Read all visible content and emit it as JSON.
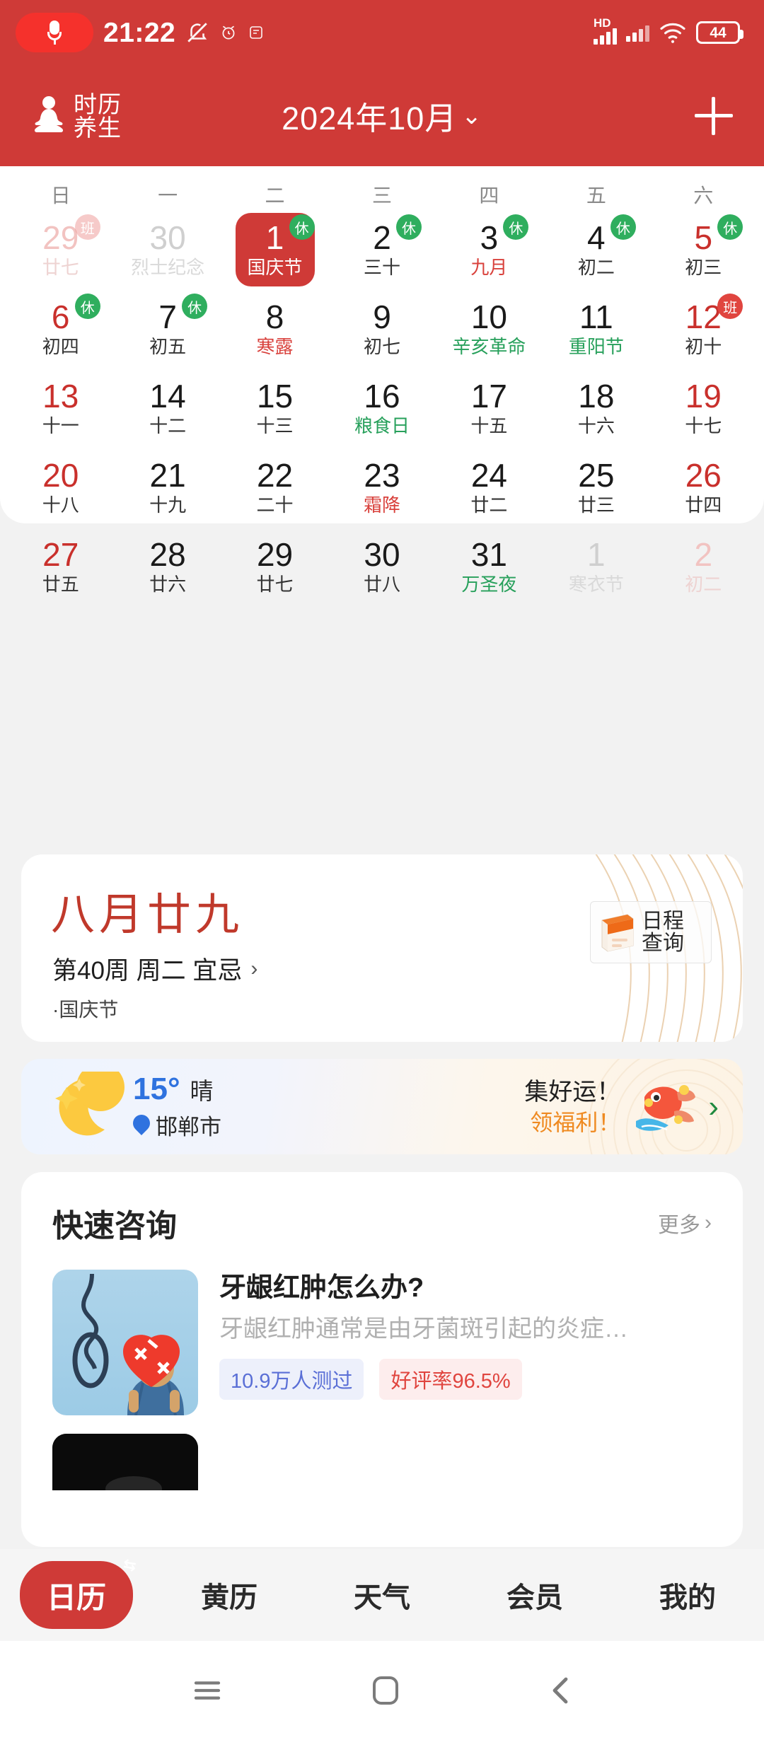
{
  "statusbar": {
    "time": "21:22",
    "battery_level": "44",
    "hd_label": "HD",
    "icons": [
      "mic-recording-icon",
      "bell-muted-icon",
      "alarm-icon",
      "app-icon"
    ]
  },
  "header": {
    "brand_line1": "时历",
    "brand_line2": "养生",
    "month_title": "2024年10月",
    "chevron": "⌄",
    "add_label": "+"
  },
  "calendar": {
    "weekdays": [
      "日",
      "一",
      "二",
      "三",
      "四",
      "五",
      "六"
    ],
    "weeks": [
      [
        {
          "num": "29",
          "sub": "廿七",
          "out": true,
          "weekend": true,
          "badge": "班",
          "badge_type": "work",
          "badge_pale": true
        },
        {
          "num": "30",
          "sub": "烈士纪念",
          "out": true
        },
        {
          "num": "1",
          "sub": "国庆节",
          "selected": true,
          "badge": "休",
          "badge_type": "rest"
        },
        {
          "num": "2",
          "sub": "三十",
          "badge": "休",
          "badge_type": "rest"
        },
        {
          "num": "3",
          "sub": "九月",
          "sub_color": "red",
          "badge": "休",
          "badge_type": "rest"
        },
        {
          "num": "4",
          "sub": "初二",
          "badge": "休",
          "badge_type": "rest"
        },
        {
          "num": "5",
          "sub": "初三",
          "weekend": true,
          "badge": "休",
          "badge_type": "rest"
        }
      ],
      [
        {
          "num": "6",
          "sub": "初四",
          "weekend": true,
          "badge": "休",
          "badge_type": "rest"
        },
        {
          "num": "7",
          "sub": "初五",
          "badge": "休",
          "badge_type": "rest"
        },
        {
          "num": "8",
          "sub": "寒露",
          "sub_color": "red"
        },
        {
          "num": "9",
          "sub": "初七"
        },
        {
          "num": "10",
          "sub": "辛亥革命",
          "sub_color": "green"
        },
        {
          "num": "11",
          "sub": "重阳节",
          "sub_color": "green"
        },
        {
          "num": "12",
          "sub": "初十",
          "weekend": true,
          "badge": "班",
          "badge_type": "work"
        }
      ],
      [
        {
          "num": "13",
          "sub": "十一",
          "weekend": true
        },
        {
          "num": "14",
          "sub": "十二"
        },
        {
          "num": "15",
          "sub": "十三"
        },
        {
          "num": "16",
          "sub": "粮食日",
          "sub_color": "green"
        },
        {
          "num": "17",
          "sub": "十五"
        },
        {
          "num": "18",
          "sub": "十六"
        },
        {
          "num": "19",
          "sub": "十七",
          "weekend": true
        }
      ],
      [
        {
          "num": "20",
          "sub": "十八",
          "weekend": true
        },
        {
          "num": "21",
          "sub": "十九"
        },
        {
          "num": "22",
          "sub": "二十"
        },
        {
          "num": "23",
          "sub": "霜降",
          "sub_color": "red"
        },
        {
          "num": "24",
          "sub": "廿二"
        },
        {
          "num": "25",
          "sub": "廿三"
        },
        {
          "num": "26",
          "sub": "廿四",
          "weekend": true
        }
      ],
      [
        {
          "num": "27",
          "sub": "廿五",
          "weekend": true
        },
        {
          "num": "28",
          "sub": "廿六"
        },
        {
          "num": "29",
          "sub": "廿七"
        },
        {
          "num": "30",
          "sub": "廿八"
        },
        {
          "num": "31",
          "sub": "万圣夜",
          "sub_color": "green"
        },
        {
          "num": "1",
          "sub": "寒衣节",
          "out": true
        },
        {
          "num": "2",
          "sub": "初二",
          "out": true,
          "weekend": true
        }
      ]
    ]
  },
  "lunar": {
    "title": "八月廿九",
    "subline": "第40周 周二 宜忌",
    "chevron": "›",
    "festival": "·国庆节",
    "schedule_button": "日程\n查询",
    "schedule_line1": "日程",
    "schedule_line2": "查询"
  },
  "weather": {
    "temp": "15°",
    "condition": "晴",
    "city": "邯郸市",
    "promo_line1": "集好运！",
    "promo_line2": "领福利！",
    "promo_chevron": "›"
  },
  "consult": {
    "title": "快速咨询",
    "more_label": "更多",
    "more_chevron": "›",
    "items": [
      {
        "question": "牙龈红肿怎么办?",
        "description": "牙龈红肿通常是由牙菌斑引起的炎症…",
        "tag_count": "10.9万人测过",
        "tag_rating": "好评率96.5%"
      }
    ]
  },
  "tabbar": {
    "items": [
      {
        "label": "日历",
        "active": true,
        "corner": "⇆"
      },
      {
        "label": "黄历",
        "active": false
      },
      {
        "label": "天气",
        "active": false
      },
      {
        "label": "会员",
        "active": false
      },
      {
        "label": "我的",
        "active": false
      }
    ]
  },
  "sysnav": {
    "menu": "menu-icon",
    "home": "home-icon",
    "back": "back-icon"
  },
  "colors": {
    "brand_red": "#cf3a37",
    "rest_green": "#2fae5e",
    "work_red": "#e0453f",
    "weekend_red": "#c9302c",
    "page_bg": "#f2f2f2"
  }
}
